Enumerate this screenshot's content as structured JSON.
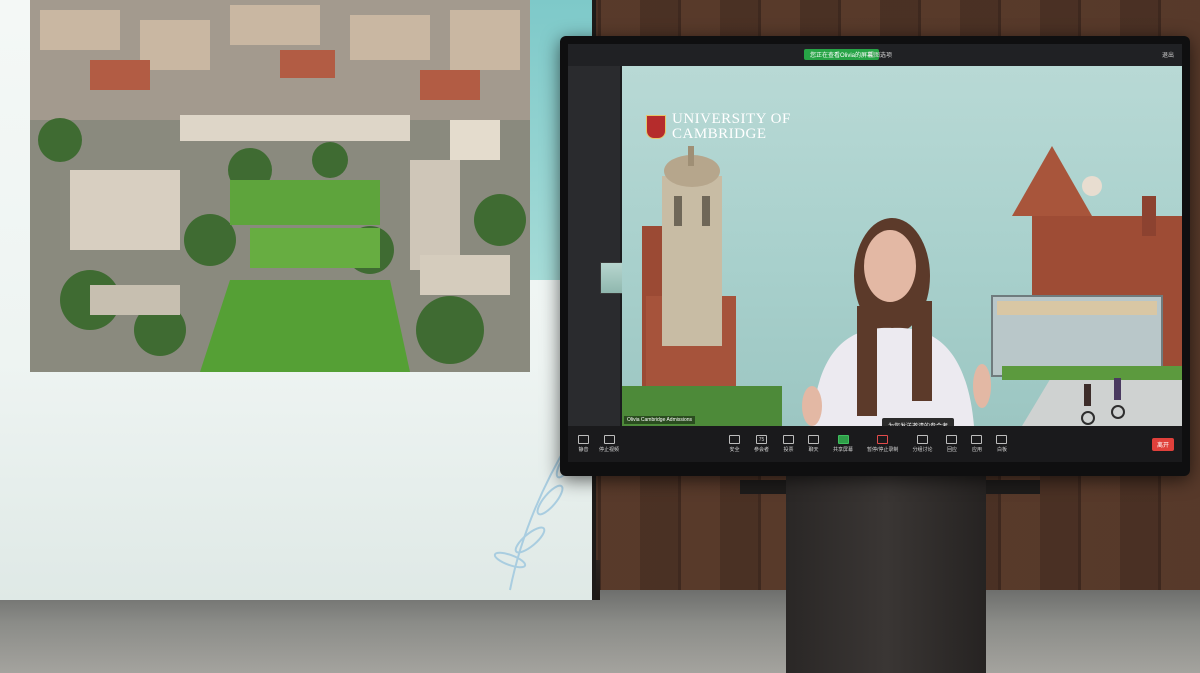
{
  "projection": {
    "photo_description_icon": "aerial-campus-photo"
  },
  "zoom": {
    "banner_text": "您正在查看Olivia的屏幕",
    "view_option": "视图选项",
    "exit_label": "退出",
    "logo_line1": "UNIVERSITY OF",
    "logo_line2": "CAMBRIDGE",
    "participant_label": "Olivia Cambridge Admissions",
    "tooltip_text": "为您发送邀请的参会者",
    "toolbar_left": [
      {
        "label": "静音",
        "icon": "mic-icon"
      },
      {
        "label": "停止视频",
        "icon": "video-icon"
      }
    ],
    "toolbar_center": [
      {
        "label": "安全",
        "icon": "shield-icon"
      },
      {
        "label": "参会者",
        "icon": "participants-icon",
        "badge": "75"
      },
      {
        "label": "投票",
        "icon": "poll-icon"
      },
      {
        "label": "聊天",
        "icon": "chat-icon"
      },
      {
        "label": "共享屏幕",
        "icon": "share-icon"
      },
      {
        "label": "暂停/停止录制",
        "icon": "record-icon"
      },
      {
        "label": "分组讨论",
        "icon": "breakout-icon"
      },
      {
        "label": "回应",
        "icon": "reaction-icon"
      },
      {
        "label": "应用",
        "icon": "apps-icon"
      },
      {
        "label": "白板",
        "icon": "whiteboard-icon"
      }
    ],
    "leave_label": "离开"
  },
  "colors": {
    "zoom_green": "#27a446",
    "leave_red": "#e0403b",
    "cambridge_red": "#b52c2c",
    "screen_teal": "#a8d0cc"
  }
}
